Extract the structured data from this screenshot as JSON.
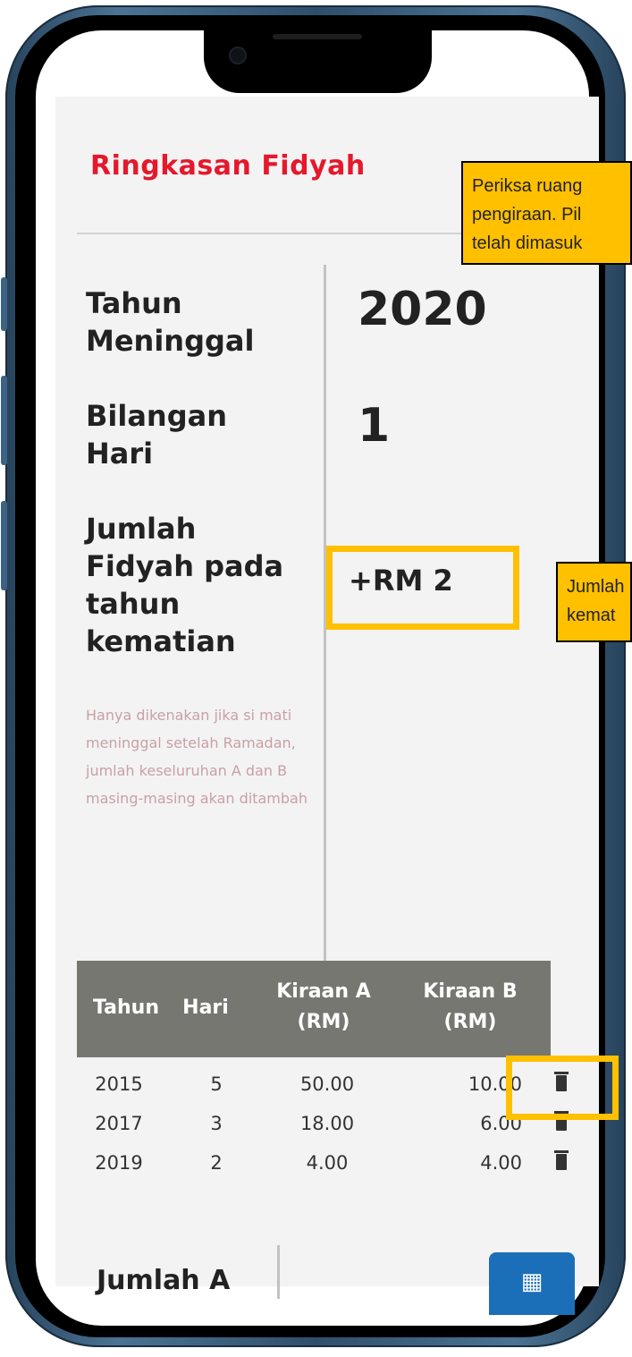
{
  "summary": {
    "title": "Ringkasan Fidyah",
    "year_label": "Tahun Meninggal",
    "year_value": "2020",
    "days_label": "Bilangan Hari",
    "days_value": "1",
    "fidyah_label": "Jumlah Fidyah pada tahun kematian",
    "fidyah_value": "+RM 2",
    "note": "Hanya dikenakan jika si mati meninggal setelah Ramadan, jumlah keseluruhan A dan B masing-masing akan ditambah"
  },
  "table": {
    "headers": [
      "Tahun",
      "Hari",
      "Kiraan A (RM)",
      "Kiraan B (RM)"
    ],
    "rows": [
      {
        "year": "2015",
        "days": "5",
        "a": "50.00",
        "b": "10.00"
      },
      {
        "year": "2017",
        "days": "3",
        "a": "18.00",
        "b": "6.00"
      },
      {
        "year": "2019",
        "days": "2",
        "a": "4.00",
        "b": "4.00"
      }
    ]
  },
  "footer": {
    "jumlah_a_label": "Jumlah A",
    "calc_button_icon": "calculator-icon"
  },
  "callouts": {
    "top_line1": "Periksa ruang",
    "top_line2": "pengiraan. Pil",
    "top_line3": "telah dimasuk",
    "mid_line1": "Jumlah",
    "mid_line2": "kemat"
  },
  "colors": {
    "title": "#e5182c",
    "highlight": "#ffc000",
    "table_header": "#777772",
    "button": "#1b6fb8",
    "phone_frame": "#3e6283"
  }
}
